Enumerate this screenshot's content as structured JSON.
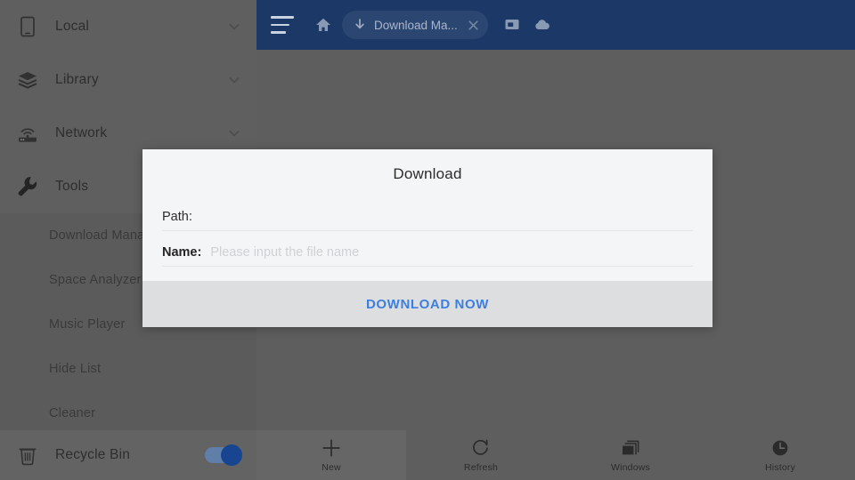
{
  "toolbar": {
    "menu_icon": "hamburger-menu-icon",
    "home_icon": "home-icon",
    "tab": {
      "icon": "download-arrow-icon",
      "title": "Download Ma...",
      "close_icon": "close-x-icon"
    },
    "windows_icon": "window-icon",
    "cloud_icon": "cloud-icon"
  },
  "sidebar": {
    "items": [
      {
        "label": "Local",
        "icon": "phone-icon",
        "chevron": "chevron-down-icon"
      },
      {
        "label": "Library",
        "icon": "layers-icon",
        "chevron": "chevron-down-icon"
      },
      {
        "label": "Network",
        "icon": "router-icon",
        "chevron": "chevron-down-icon"
      },
      {
        "label": "Tools",
        "icon": "wrench-icon",
        "chevron": ""
      }
    ],
    "tools_submenu": [
      {
        "label": "Download Mana"
      },
      {
        "label": "Space Analyzer"
      },
      {
        "label": "Music Player"
      },
      {
        "label": "Hide List"
      },
      {
        "label": "Cleaner"
      }
    ],
    "footer": {
      "label": "Recycle Bin",
      "icon": "trash-icon",
      "toggle_on": true,
      "toggle_color": "#17458f"
    }
  },
  "bottombar": {
    "items": [
      {
        "label": "New",
        "icon": "plus-icon",
        "active": true
      },
      {
        "label": "Refresh",
        "icon": "refresh-icon",
        "active": false
      },
      {
        "label": "Windows",
        "icon": "windows-stack-icon",
        "active": false
      },
      {
        "label": "History",
        "icon": "clock-icon",
        "active": false
      }
    ]
  },
  "dialog": {
    "title": "Download",
    "path": {
      "label": "Path:",
      "value": ""
    },
    "name": {
      "label": "Name:",
      "value": "",
      "placeholder": "Please input the file name"
    },
    "primary_action": "DOWNLOAD NOW",
    "accent_color": "#3c7fe0"
  }
}
